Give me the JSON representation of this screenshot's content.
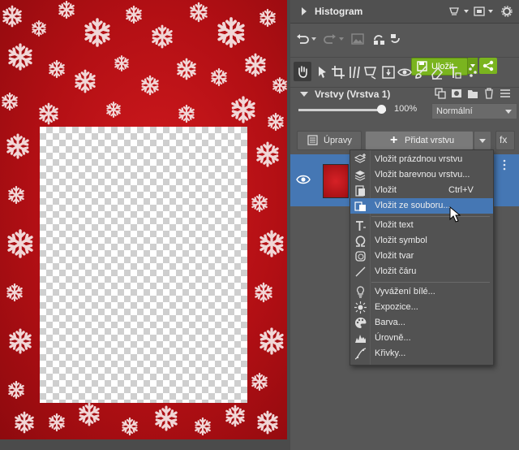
{
  "histogram": {
    "title": "Histogram"
  },
  "toolbar": {
    "save_label": "Uložit"
  },
  "layers": {
    "title": "Vrstvy (Vrstva 1)",
    "opacity": "100%",
    "opacity_value": 100,
    "blend_mode": "Normální",
    "adjust_label": "Úpravy",
    "add_layer_label": "Přidat vrstvu",
    "fx_label": "fx"
  },
  "menu": {
    "items": [
      {
        "label": "Vložit prázdnou vrstvu",
        "icon": "empty-layer-icon"
      },
      {
        "label": "Vložit barevnou vrstvu...",
        "icon": "color-layer-icon"
      },
      {
        "label": "Vložit",
        "icon": "paste-icon",
        "shortcut": "Ctrl+V"
      },
      {
        "label": "Vložit ze souboru...",
        "icon": "paste-from-file-icon",
        "highlighted": true
      },
      {
        "label": "Vložit text",
        "icon": "text-icon"
      },
      {
        "label": "Vložit symbol",
        "icon": "omega-icon"
      },
      {
        "label": "Vložit tvar",
        "icon": "shape-icon"
      },
      {
        "label": "Vložit čáru",
        "icon": "line-icon"
      },
      {
        "label": "Vyvážení bílé...",
        "icon": "white-balance-icon"
      },
      {
        "label": "Expozice...",
        "icon": "exposure-icon"
      },
      {
        "label": "Barva...",
        "icon": "palette-icon"
      },
      {
        "label": "Úrovně...",
        "icon": "levels-icon"
      },
      {
        "label": "Křivky...",
        "icon": "curves-icon"
      }
    ]
  },
  "colors": {
    "accent_blue": "#4577b4",
    "save_green": "#7ab41f",
    "background_red": "#b20f14"
  }
}
